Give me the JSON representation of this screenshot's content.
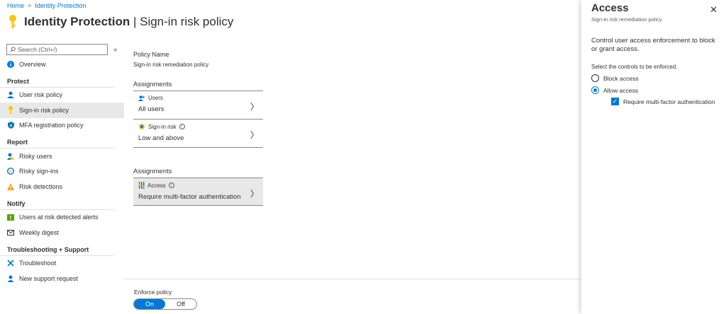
{
  "breadcrumb": {
    "home": "Home",
    "separator": ">",
    "current": "Identity Protection"
  },
  "header": {
    "title": "Identity Protection",
    "divider": " | ",
    "subtitle": "Sign-in risk policy"
  },
  "sidebar": {
    "search_placeholder": "Search (Ctrl+/)",
    "collapse": "«",
    "overview": "Overview",
    "sections": {
      "protect": "Protect",
      "report": "Report",
      "notify": "Notify",
      "troubleshooting": "Troubleshooting + Support"
    },
    "items": {
      "user_risk_policy": "User risk policy",
      "signin_risk_policy": "Sign-in risk policy",
      "mfa_registration_policy": "MFA registration policy",
      "risky_users": "Risky users",
      "risky_signins": "Risky sign-ins",
      "risk_detections": "Risk detections",
      "users_at_risk_alerts": "Users at risk detected alerts",
      "weekly_digest": "Weekly digest",
      "troubleshoot": "Troubleshoot",
      "new_support_request": "New support request"
    }
  },
  "main": {
    "policy_name_label": "Policy Name",
    "policy_name_value": "Sign-in risk remediation policy",
    "assignments_label_1": "Assignments",
    "users_label": "Users",
    "users_value": "All users",
    "signin_risk_label": "Sign-in risk",
    "signin_risk_value": "Low and above",
    "assignments_label_2": "Assignments",
    "access_label": "Access",
    "access_value": "Require multi-factor authentication",
    "enforce_label": "Enforce policy",
    "toggle_on": "On",
    "toggle_off": "Off"
  },
  "panel": {
    "title": "Access",
    "subtitle": "Sign-in risk remediation policy",
    "description": "Control user access enforcement to block or grant access.",
    "select_label": "Select the controls to be enforced.",
    "block_access": "Block access",
    "allow_access": "Allow access",
    "require_mfa": "Require multi-factor authentication"
  },
  "icons": {
    "key": "key-icon",
    "search": "search-icon",
    "info": "info-icon",
    "close": "close-icon",
    "chevron": "chevron-right-icon"
  },
  "colors": {
    "accent": "#0078d4",
    "key_yellow": "#f2c811",
    "active_bg": "#e8e8e8"
  }
}
